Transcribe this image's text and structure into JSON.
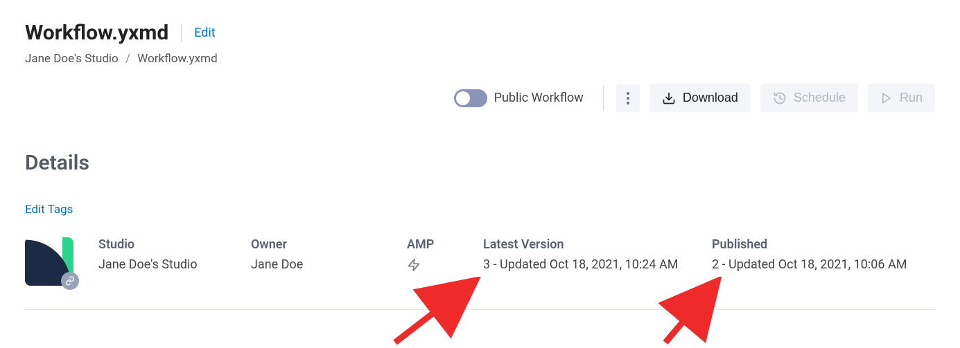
{
  "header": {
    "title": "Workflow.yxmd",
    "edit_label": "Edit",
    "breadcrumb_parent": "Jane Doe's Studio",
    "breadcrumb_sep": "/",
    "breadcrumb_current": "Workflow.yxmd"
  },
  "toolbar": {
    "toggle_label": "Public Workflow",
    "download_label": "Download",
    "schedule_label": "Schedule",
    "run_label": "Run"
  },
  "details": {
    "section_title": "Details",
    "edit_tags_label": "Edit Tags",
    "studio": {
      "label": "Studio",
      "value": "Jane Doe's Studio"
    },
    "owner": {
      "label": "Owner",
      "value": "Jane Doe"
    },
    "amp_label": "AMP",
    "latest_version": {
      "label": "Latest Version",
      "number": "3",
      "rest": " - Updated Oct 18, 2021, 10:24 AM"
    },
    "published": {
      "label": "Published",
      "number": "2",
      "rest": " - Updated Oct 18, 2021, 10:06 AM"
    }
  }
}
